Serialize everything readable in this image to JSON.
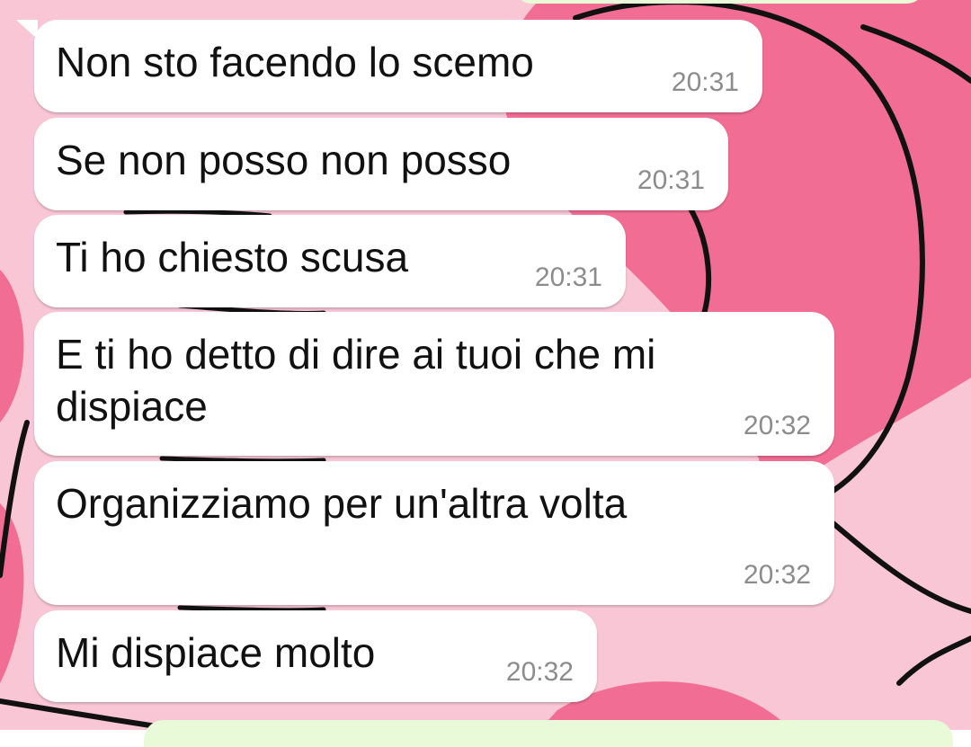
{
  "theme": {
    "wallpaper_base": "#f9c6d6",
    "wallpaper_blob": "#f26d93",
    "wallpaper_line": "#111111",
    "incoming_bubble": "#ffffff",
    "outgoing_bubble": "#e9fad8",
    "time_color": "#8c8c8c"
  },
  "messages": [
    {
      "text": "Non sto facendo lo scemo",
      "time": "20:31"
    },
    {
      "text": "Se non posso non posso",
      "time": "20:31"
    },
    {
      "text": "Ti ho chiesto scusa",
      "time": "20:31"
    },
    {
      "text": "E ti ho detto di dire ai tuoi che mi\ndispiace",
      "time": "20:32"
    },
    {
      "text": "Organizziamo per un'altra volta",
      "time": "20:32"
    },
    {
      "text": "Mi dispiace molto",
      "time": "20:32"
    }
  ]
}
